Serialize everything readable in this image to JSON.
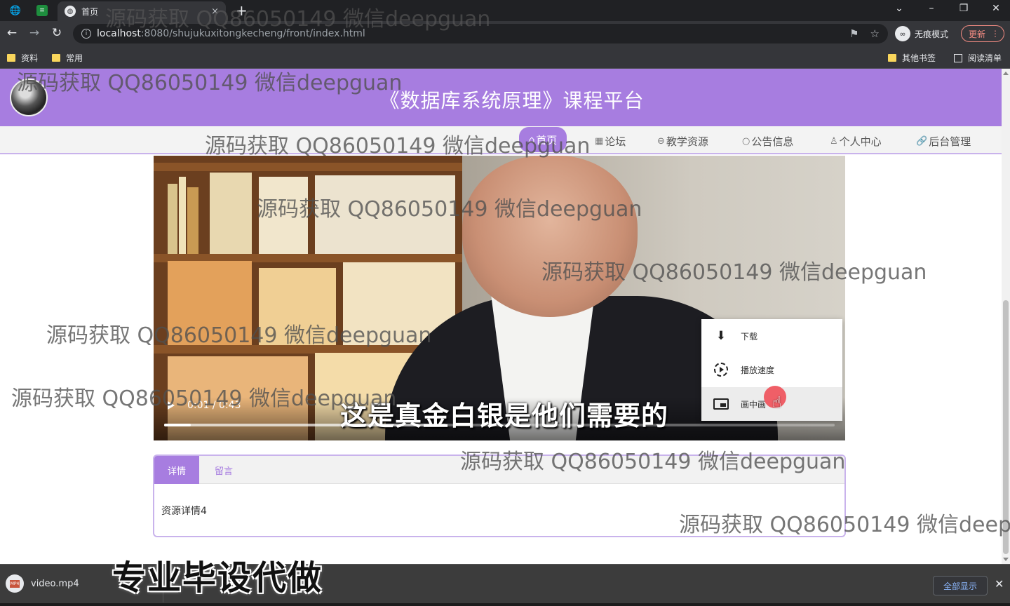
{
  "browser": {
    "tab_title": "首页",
    "tab_close": "×",
    "new_tab": "+",
    "url_host": "localhost",
    "url_path": ":8080/shujukuxitongkecheng/front/index.html",
    "incognito_label": "无痕模式",
    "update_label": "更新",
    "bookmarks": [
      "资料",
      "常用"
    ],
    "other_bookmarks": "其他书签",
    "reading_list": "阅读清单"
  },
  "site": {
    "title": "《数据库系统原理》课程平台",
    "nav": [
      {
        "label": "首页",
        "icon": "home-icon",
        "active": true
      },
      {
        "label": "论坛",
        "icon": "forum-icon",
        "active": false
      },
      {
        "label": "教学资源",
        "icon": "resource-icon",
        "active": false
      },
      {
        "label": "公告信息",
        "icon": "notice-icon",
        "active": false
      },
      {
        "label": "个人中心",
        "icon": "user-icon",
        "active": false
      },
      {
        "label": "后台管理",
        "icon": "link-icon",
        "active": false
      }
    ]
  },
  "video": {
    "time": "0:01 / 0:43",
    "subtitle": "这是真金白银是他们需要的",
    "played_fraction": 0.04,
    "buffered_fraction": 0.42,
    "context_menu": [
      {
        "label": "下载",
        "icon": "download-icon"
      },
      {
        "label": "播放速度",
        "icon": "playback-speed-icon"
      },
      {
        "label": "画中画",
        "icon": "picture-in-picture-icon"
      }
    ]
  },
  "details": {
    "tabs": [
      "详情",
      "留言"
    ],
    "content": "资源详情4"
  },
  "downloads": {
    "filename": "video.mp4",
    "file_badge": "MP4",
    "show_all": "全部显示"
  },
  "overlay": {
    "watermark": "源码获取 QQ86050149 微信deepguan",
    "promo": "专业毕设代做"
  },
  "colors": {
    "brand": "#a77de0",
    "chrome_dark": "#202124",
    "chrome_toolbar": "#35363a"
  }
}
